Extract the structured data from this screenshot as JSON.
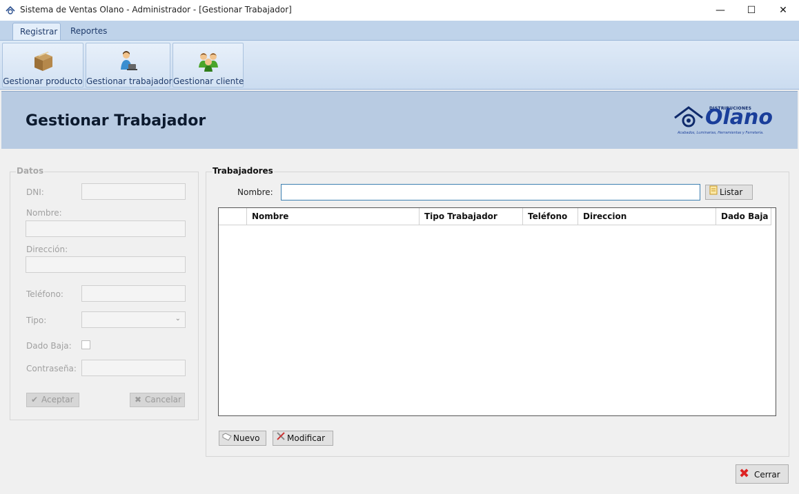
{
  "window": {
    "title": "Sistema de Ventas Olano - Administrador - [Gestionar Trabajador]",
    "minimize": "—",
    "maximize": "☐",
    "close": "✕"
  },
  "ribbon": {
    "tabs": [
      "Registrar",
      "Reportes"
    ],
    "buttons": [
      {
        "label": "Gestionar producto",
        "icon": "box-icon"
      },
      {
        "label": "Gestionar trabajador",
        "icon": "worker-icon"
      },
      {
        "label": "Gestionar cliente",
        "icon": "clients-icon"
      }
    ]
  },
  "header": {
    "title": "Gestionar Trabajador",
    "logo": {
      "small": "DISTRIBUCIONES",
      "name": "Olano",
      "tagline": "Acabados, Luminarias, Herramientas y Ferretería."
    }
  },
  "datos": {
    "title": "Datos",
    "dni_label": "DNI:",
    "nombre_label": "Nombre:",
    "direccion_label": "Dirección:",
    "telefono_label": "Teléfono:",
    "tipo_label": "Tipo:",
    "dado_baja_label": "Dado Baja:",
    "contrasena_label": "Contraseña:",
    "aceptar": "Aceptar",
    "cancelar": "Cancelar"
  },
  "trabajadores": {
    "title": "Trabajadores",
    "nombre_label": "Nombre:",
    "search_value": "",
    "listar": "Listar",
    "columns": [
      "Nombre",
      "Tipo Trabajador",
      "Teléfono",
      "Direccion",
      "Dado Baja"
    ],
    "rows": [],
    "nuevo": "Nuevo",
    "modificar": "Modificar"
  },
  "footer": {
    "cerrar": "Cerrar"
  }
}
